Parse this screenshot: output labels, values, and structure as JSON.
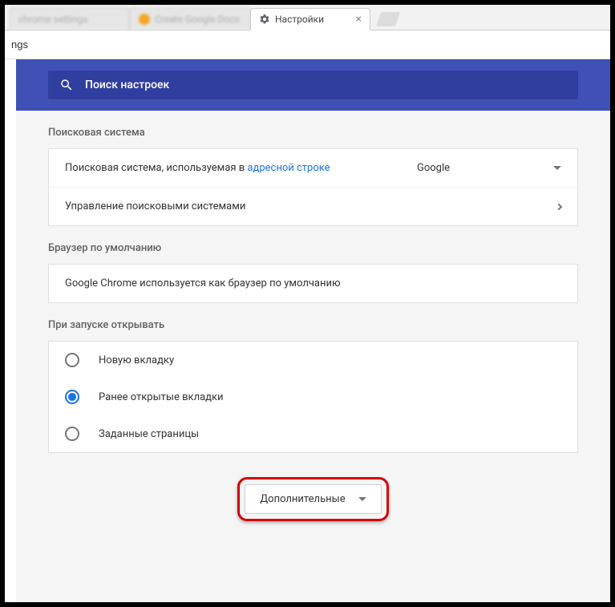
{
  "tabs": {
    "active_title": "Настройки"
  },
  "address_fragment": "ngs",
  "search": {
    "placeholder": "Поиск настроек"
  },
  "search_engine": {
    "title": "Поисковая система",
    "row1_prefix": "Поисковая система, используемая в ",
    "row1_link": "адресной строке",
    "selected": "Google",
    "row2": "Управление поисковыми системами"
  },
  "default_browser": {
    "title": "Браузер по умолчанию",
    "status": "Google Chrome используется как браузер по умолчанию"
  },
  "startup": {
    "title": "При запуске открывать",
    "options": [
      "Новую вкладку",
      "Ранее открытые вкладки",
      "Заданные страницы"
    ],
    "selected_index": 1
  },
  "advanced_label": "Дополнительные"
}
